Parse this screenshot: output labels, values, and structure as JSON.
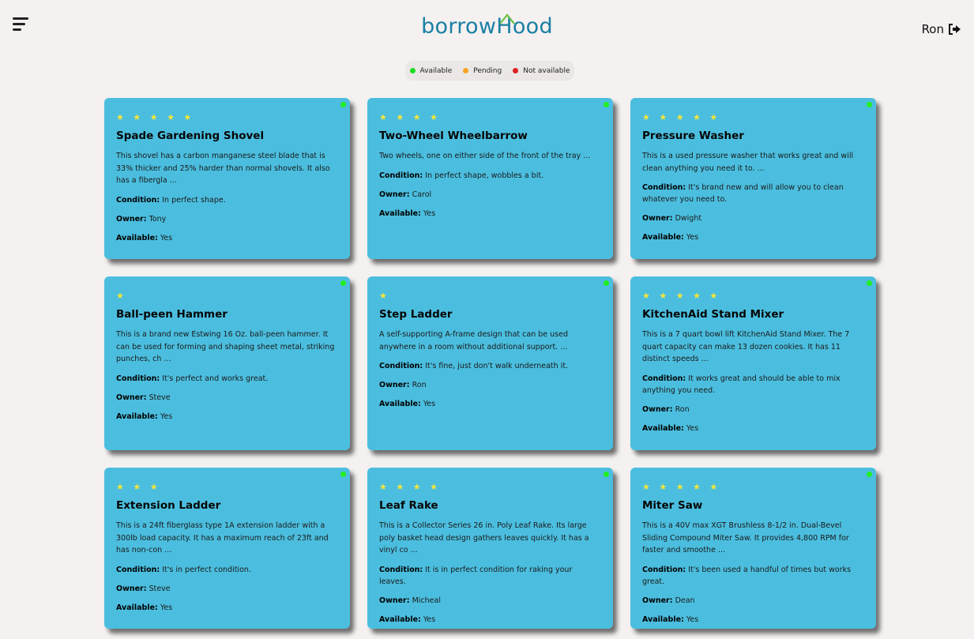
{
  "header": {
    "logo_text": "borrowHood",
    "user_name": "Ron"
  },
  "legend": {
    "items": [
      {
        "label": "Available",
        "color": "#1fdc1f"
      },
      {
        "label": "Pending",
        "color": "#f5a623"
      },
      {
        "label": "Not available",
        "color": "#e02020"
      }
    ]
  },
  "labels": {
    "condition": "Condition:",
    "owner": "Owner:",
    "available": "Available:"
  },
  "items": [
    {
      "stars": "★ ★ ★ ★ ★",
      "title": "Spade Gardening Shovel",
      "description": "This shovel has a carbon manganese steel blade that is 33% thicker and 25% harder than normal shovels. It also has a fibergla ...",
      "condition": "In perfect shape.",
      "owner": "Tony",
      "available": "Yes"
    },
    {
      "stars": "★ ★ ★ ★",
      "title": "Two-Wheel Wheelbarrow",
      "description": "Two wheels, one on either side of the front of the tray ...",
      "condition": "In perfect shape, wobbles a bit.",
      "owner": "Carol",
      "available": "Yes"
    },
    {
      "stars": "★ ★ ★ ★ ★",
      "title": "Pressure Washer",
      "description": "This is a used pressure washer that works great and will clean anything you need it to. ...",
      "condition": "It's brand new and will allow you to clean whatever you need to.",
      "owner": "Dwight",
      "available": "Yes"
    },
    {
      "stars": "★",
      "title": "Ball-peen Hammer",
      "description": "This is a brand new Estwing 16 Oz. ball-peen hammer. It can be used for forming and shaping sheet metal, striking punches, ch ...",
      "condition": "It's perfect and works great.",
      "owner": "Steve",
      "available": "Yes"
    },
    {
      "stars": "★",
      "title": "Step Ladder",
      "description": "A self-supporting A-frame design that can be used anywhere in a room without additional support. ...",
      "condition": "It's fine, just don't walk underneath it.",
      "owner": "Ron",
      "available": "Yes"
    },
    {
      "stars": "★ ★ ★ ★ ★",
      "title": "KitchenAid Stand Mixer",
      "description": "This is a 7 quart bowl lift KitchenAid Stand Mixer. The 7 quart capacity can make 13 dozen cookies. It has 11 distinct speeds ...",
      "condition": "It works great and should be able to mix anything you need.",
      "owner": "Ron",
      "available": "Yes"
    },
    {
      "stars": "★ ★ ★",
      "title": "Extension Ladder",
      "description": "This is a 24ft fiberglass type 1A extension ladder with a 300lb load capacity. It has a maximum reach of 23ft and has non-con ...",
      "condition": "It's in perfect condition.",
      "owner": "Steve",
      "available": "Yes"
    },
    {
      "stars": "★ ★ ★ ★",
      "title": "Leaf Rake",
      "description": "This is a Collector Series 26 in. Poly Leaf Rake. Its large poly basket head design gathers leaves quickly. It has a vinyl co ...",
      "condition": "It is in perfect condition for raking your leaves.",
      "owner": "Micheal",
      "available": "Yes"
    },
    {
      "stars": "★ ★ ★ ★ ★",
      "title": "Miter Saw",
      "description": "This is a 40V max XGT Brushless 8-1/2 in. Dual-Bevel Sliding Compound Miter Saw. It provides 4,800 RPM for faster and smoothe ...",
      "condition": "It's been used a handful of times but works great.",
      "owner": "Dean",
      "available": "Yes"
    }
  ]
}
